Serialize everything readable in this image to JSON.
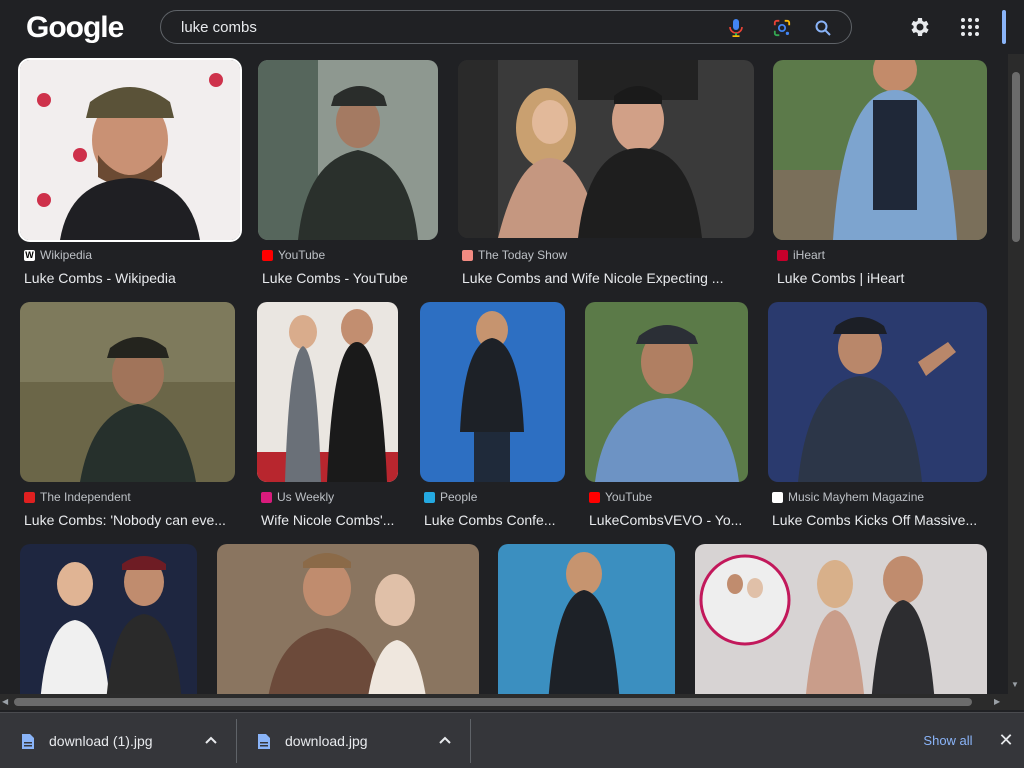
{
  "header": {
    "logo_text": "Google",
    "search_query": "luke combs",
    "icons": [
      "mic-icon",
      "google-lens-icon",
      "search-icon",
      "settings-gear-icon",
      "apps-grid-icon"
    ]
  },
  "results": [
    {
      "source": "Wikipedia",
      "title": "Luke Combs - Wikipedia",
      "favicon_color": "#ffffff",
      "favicon_text": "W"
    },
    {
      "source": "YouTube",
      "title": "Luke Combs - YouTube",
      "favicon_color": "#ff0000",
      "favicon_text": "▶"
    },
    {
      "source": "The Today Show",
      "title": "Luke Combs and Wife Nicole Expecting ...",
      "favicon_color": "#f28b82",
      "favicon_text": ""
    },
    {
      "source": "iHeart",
      "title": "Luke Combs | iHeart",
      "favicon_color": "#c6002b",
      "favicon_text": ""
    },
    {
      "source": "The Independent",
      "title": "Luke Combs: 'Nobody can eve...",
      "favicon_color": "#e02020",
      "favicon_text": ""
    },
    {
      "source": "Us Weekly",
      "title": "Wife Nicole Combs'...",
      "favicon_color": "#d81b7c",
      "favicon_text": "U"
    },
    {
      "source": "People",
      "title": "Luke Combs Confe...",
      "favicon_color": "#24a9e1",
      "favicon_text": "P"
    },
    {
      "source": "YouTube",
      "title": "LukeCombsVEVO - Yo...",
      "favicon_color": "#ff0000",
      "favicon_text": "▶"
    },
    {
      "source": "Music Mayhem Magazine",
      "title": "Luke Combs Kicks Off Massive...",
      "favicon_color": "#ffffff",
      "favicon_text": ""
    }
  ],
  "downloads": {
    "items": [
      {
        "name": "download (1).jpg"
      },
      {
        "name": "download.jpg"
      }
    ],
    "show_all_label": "Show all",
    "close_label": "✕"
  }
}
